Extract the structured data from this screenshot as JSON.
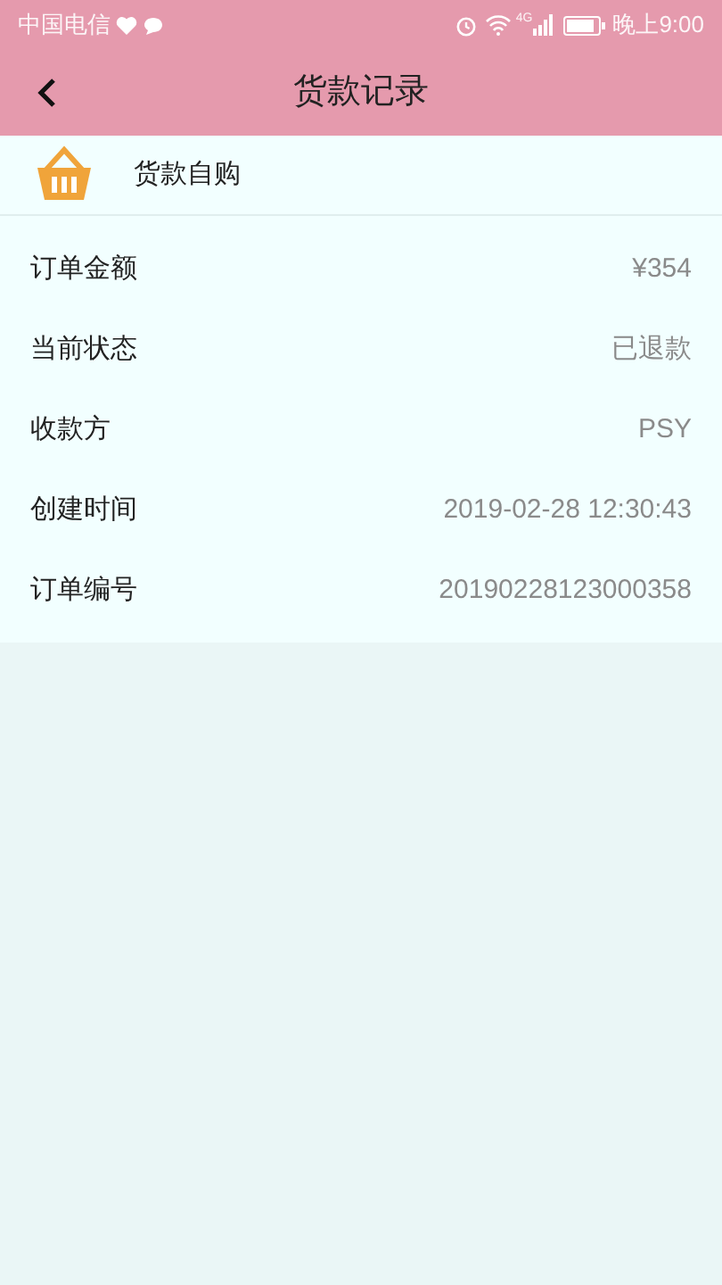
{
  "status_bar": {
    "carrier": "中国电信",
    "network": "4G",
    "time": "晚上9:00"
  },
  "header": {
    "title": "货款记录"
  },
  "category": {
    "label": "货款自购"
  },
  "details": [
    {
      "label": "订单金额",
      "value": "¥354"
    },
    {
      "label": "当前状态",
      "value": "已退款"
    },
    {
      "label": "收款方",
      "value": "PSY"
    },
    {
      "label": "创建时间",
      "value": "2019-02-28 12:30:43"
    },
    {
      "label": "订单编号",
      "value": "20190228123000358"
    }
  ]
}
